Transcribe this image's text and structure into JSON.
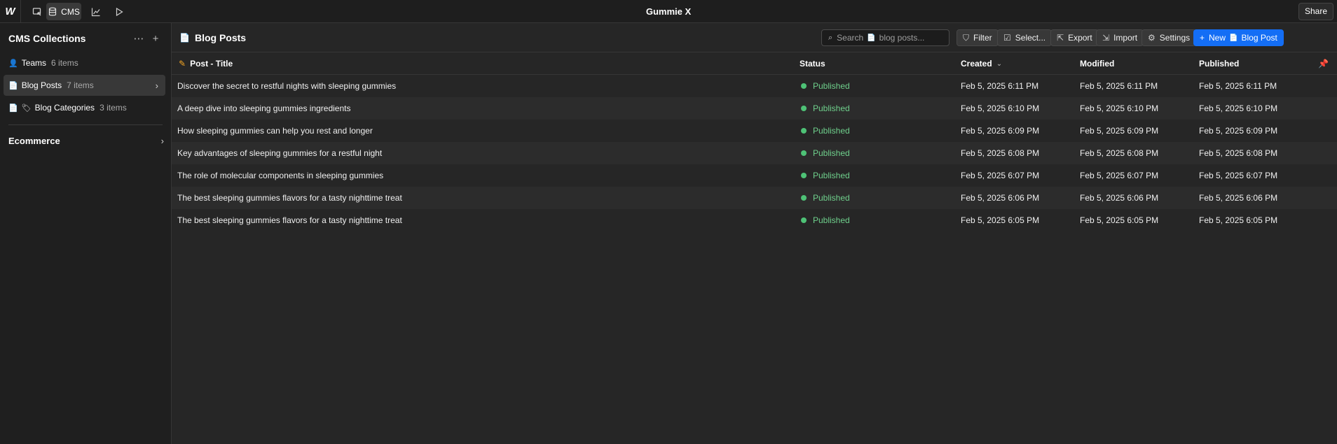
{
  "app": {
    "title": "Gummie X",
    "share_label": "Share"
  },
  "topbar": {
    "cms_label": "CMS"
  },
  "sidebar": {
    "title": "CMS Collections",
    "collections": [
      {
        "icon": "person-icon",
        "name": "Teams",
        "count": "6 items"
      },
      {
        "icon": "document-icon",
        "name": "Blog Posts",
        "count": "7 items"
      },
      {
        "icon": "document-tag-icon",
        "name": "Blog Categories",
        "count": "3 items"
      }
    ],
    "ecommerce_label": "Ecommerce"
  },
  "main": {
    "title": "Blog Posts",
    "search_placeholder": "blog posts...",
    "search_prefix": "Search",
    "buttons": {
      "filter": "Filter",
      "select": "Select...",
      "export": "Export",
      "import": "Import",
      "settings": "Settings",
      "new_prefix": "New",
      "new_suffix": "Blog Post"
    },
    "columns": [
      "Post - Title",
      "Status",
      "Created",
      "Modified",
      "Published"
    ],
    "rows": [
      {
        "title": "Discover the secret to restful nights with sleeping gummies",
        "status": "Published",
        "created": "Feb 5, 2025 6:11 PM",
        "modified": "Feb 5, 2025 6:11 PM",
        "published": "Feb 5, 2025 6:11 PM"
      },
      {
        "title": "A deep dive into sleeping gummies ingredients",
        "status": "Published",
        "created": "Feb 5, 2025 6:10 PM",
        "modified": "Feb 5, 2025 6:10 PM",
        "published": "Feb 5, 2025 6:10 PM"
      },
      {
        "title": "How sleeping gummies can help you rest and longer",
        "status": "Published",
        "created": "Feb 5, 2025 6:09 PM",
        "modified": "Feb 5, 2025 6:09 PM",
        "published": "Feb 5, 2025 6:09 PM"
      },
      {
        "title": "Key advantages of sleeping gummies for a restful night",
        "status": "Published",
        "created": "Feb 5, 2025 6:08 PM",
        "modified": "Feb 5, 2025 6:08 PM",
        "published": "Feb 5, 2025 6:08 PM"
      },
      {
        "title": "The role of molecular components in sleeping gummies",
        "status": "Published",
        "created": "Feb 5, 2025 6:07 PM",
        "modified": "Feb 5, 2025 6:07 PM",
        "published": "Feb 5, 2025 6:07 PM"
      },
      {
        "title": "The best sleeping gummies flavors for a tasty nighttime treat",
        "status": "Published",
        "created": "Feb 5, 2025 6:06 PM",
        "modified": "Feb 5, 2025 6:06 PM",
        "published": "Feb 5, 2025 6:06 PM"
      },
      {
        "title": "The best sleeping gummies flavors for a tasty nighttime treat",
        "status": "Published",
        "created": "Feb 5, 2025 6:05 PM",
        "modified": "Feb 5, 2025 6:05 PM",
        "published": "Feb 5, 2025 6:05 PM"
      }
    ]
  },
  "colors": {
    "accent": "#146ef5",
    "status_published": "#4ec276"
  }
}
